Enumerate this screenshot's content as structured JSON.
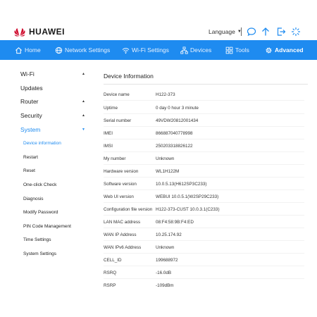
{
  "header": {
    "brand": "HUAWEI",
    "language_label": "Language",
    "brand_color": "#cf0a2c",
    "icons": [
      "chat-icon",
      "upload-arrow-icon",
      "logout-icon",
      "loading-icon"
    ]
  },
  "nav": {
    "color": "#1e8bf0",
    "items": [
      {
        "label": "Home",
        "icon": "home-icon"
      },
      {
        "label": "Network Settings",
        "icon": "globe-icon"
      },
      {
        "label": "Wi-Fi Settings",
        "icon": "wifi-icon"
      },
      {
        "label": "Devices",
        "icon": "devices-icon"
      },
      {
        "label": "Tools",
        "icon": "tools-icon"
      },
      {
        "label": "Advanced",
        "icon": "gear-icon",
        "active": true
      }
    ]
  },
  "sidebar": {
    "sections": [
      {
        "label": "Wi-Fi",
        "arrow": "▲"
      },
      {
        "label": "Updates",
        "arrow": ""
      },
      {
        "label": "Router",
        "arrow": "▲"
      },
      {
        "label": "Security",
        "arrow": "▲"
      },
      {
        "label": "System",
        "arrow": "▼",
        "active": true
      }
    ],
    "system_items": [
      {
        "label": "Device information",
        "active": true
      },
      {
        "label": "Restart"
      },
      {
        "label": "Reset"
      },
      {
        "label": "One-click Check"
      },
      {
        "label": "Diagnosis"
      },
      {
        "label": "Modify Password"
      },
      {
        "label": "PIN Code Management"
      },
      {
        "label": "Time Settings"
      },
      {
        "label": "System Settings"
      }
    ]
  },
  "main": {
    "title": "Device Information",
    "rows": [
      {
        "label": "Device name",
        "value": "H122-373"
      },
      {
        "label": "Uptime",
        "value": "0 day 0 hour 3 minute"
      },
      {
        "label": "Serial number",
        "value": "49VDW20812001434"
      },
      {
        "label": "IMEI",
        "value": "866887040778998"
      },
      {
        "label": "IMSI",
        "value": "250203318826122"
      },
      {
        "label": "My number",
        "value": "Unknown"
      },
      {
        "label": "Hardware version",
        "value": "WL1H122M"
      },
      {
        "label": "Software version",
        "value": "10.0.5.13(H612SP3C233)"
      },
      {
        "label": "Web UI version",
        "value": "WEBUI 10.0.5.1(W2SP29C233)"
      },
      {
        "label": "Configuration file version",
        "value": "H122-373-CUST 10.0.3.1(C233)"
      },
      {
        "label": "LAN MAC address",
        "value": "08:F4:58:9B:F4:ED"
      },
      {
        "label": "WAN IP Address",
        "value": "10.25.174.92"
      },
      {
        "label": "WAN IPv6 Address",
        "value": "Unknown"
      },
      {
        "label": "CELL_ID",
        "value": "199688972"
      },
      {
        "label": "RSRQ",
        "value": "-16.0dB"
      },
      {
        "label": "RSRP",
        "value": "-109dBm"
      }
    ]
  }
}
